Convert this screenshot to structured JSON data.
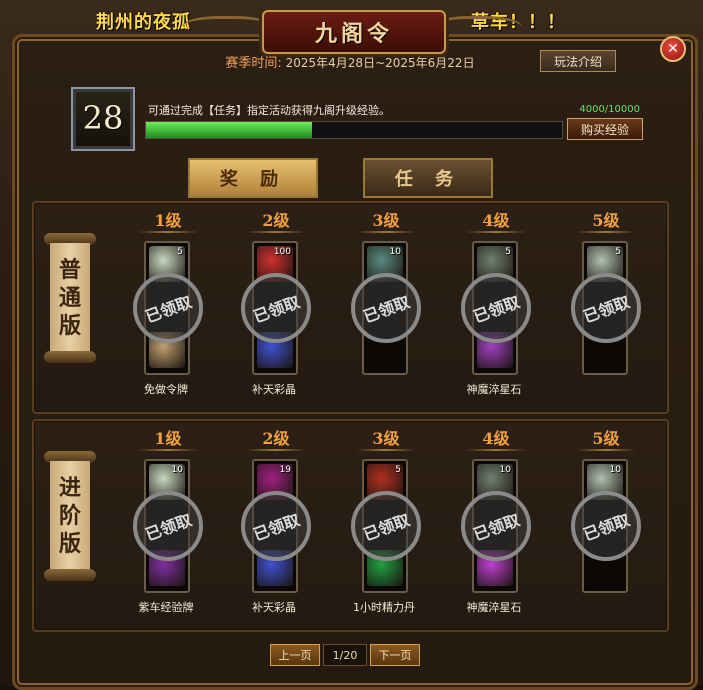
{
  "marquee": {
    "left": "荆州的夜孤",
    "right": "草车！！！"
  },
  "window": {
    "title": "九阁令",
    "close_label": "✕"
  },
  "season": {
    "label": "赛季时间:",
    "range": "2025年4月28日~2025年6月22日"
  },
  "rules_button": "玩法介绍",
  "level": {
    "value": "28"
  },
  "hint": "可通过完成【任务】指定活动获得九阁升级经验。",
  "exp": {
    "text": "4000/10000",
    "fraction": 0.4
  },
  "buy_button": "购买经验",
  "tabs": [
    {
      "label": "奖 励",
      "active": true
    },
    {
      "label": "任 务",
      "active": false
    }
  ],
  "levels": [
    "1级",
    "2级",
    "3级",
    "4级",
    "5级"
  ],
  "stamp_text": "已领取",
  "tracks": [
    {
      "title": "普通版",
      "title_chars": [
        "普",
        "通",
        "版"
      ],
      "columns": [
        {
          "qty": "5",
          "name": "免做令牌",
          "top_color": "#c8d8c0",
          "bottom_color": "#c0a070"
        },
        {
          "qty": "100",
          "name": "补天彩晶",
          "top_color": "#d03030",
          "bottom_color": "#4050d0"
        },
        {
          "qty": "10",
          "name": "",
          "top_color": "#5a8a80",
          "bottom_color": ""
        },
        {
          "qty": "5",
          "name": "神魔淬星石",
          "top_color": "#708070",
          "bottom_color": "#a040c0"
        },
        {
          "qty": "5",
          "name": "",
          "top_color": "#b0c0b0",
          "bottom_color": ""
        }
      ]
    },
    {
      "title": "进阶版",
      "title_chars": [
        "进",
        "阶",
        "版"
      ],
      "columns": [
        {
          "qty": "10",
          "name": "紫车经验牌",
          "top_color": "#c8d8c0",
          "bottom_color": "#8030a0"
        },
        {
          "qty": "19",
          "name": "补天彩晶",
          "top_color": "#a02080",
          "bottom_color": "#4050d0"
        },
        {
          "qty": "5",
          "name": "1小时精力丹",
          "top_color": "#b03020",
          "bottom_color": "#20a040"
        },
        {
          "qty": "10",
          "name": "神魔淬星石",
          "top_color": "#708070",
          "bottom_color": "#c040d0"
        },
        {
          "qty": "10",
          "name": "",
          "top_color": "#b0c0b0",
          "bottom_color": ""
        }
      ]
    }
  ],
  "pager": {
    "prev": "上一页",
    "page": "1/20",
    "next": "下一页"
  }
}
